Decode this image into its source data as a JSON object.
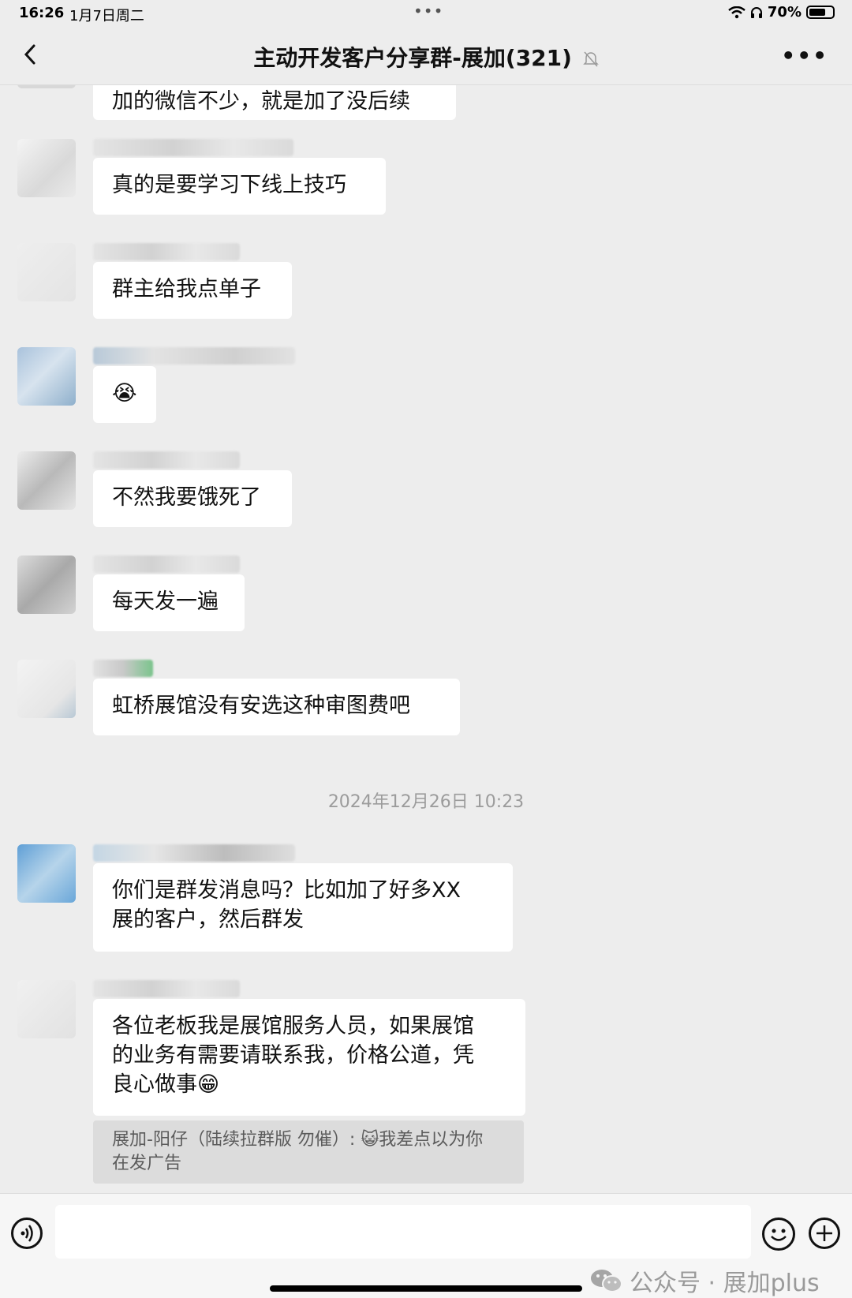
{
  "status_bar": {
    "time": "16:26",
    "date": "1月7日周二",
    "battery": "70%",
    "battery_level": 0.7
  },
  "nav": {
    "title": "主动开发客户分享群-展加(321)"
  },
  "messages": [
    {
      "text": "加的微信不少，就是加了没后续"
    },
    {
      "text": "真的是要学习下线上技巧"
    },
    {
      "text": "群主给我点单子"
    },
    {
      "text": "😭"
    },
    {
      "text": "不然我要饿死了"
    },
    {
      "text": "每天发一遍"
    },
    {
      "text": "虹桥展馆没有安选这种审图费吧"
    },
    {
      "text": "你们是群发消息吗？比如加了好多XX\n展的客户，然后群发"
    },
    {
      "text": "各位老板我是展馆服务人员，如果展馆\n的业务有需要请联系我，价格公道，凭\n良心做事😁"
    }
  ],
  "timestamp": "2024年12月26日 10:23",
  "quote": {
    "text": "展加-阳仔（陆续拉群版 勿催）: 😺我差点以为你\n在发广告"
  },
  "watermark": {
    "text": "公众号 · 展加plus"
  },
  "colors": {
    "background": "#ededed",
    "bubble": "#ffffff",
    "quote_bg": "#dcdcdc"
  }
}
